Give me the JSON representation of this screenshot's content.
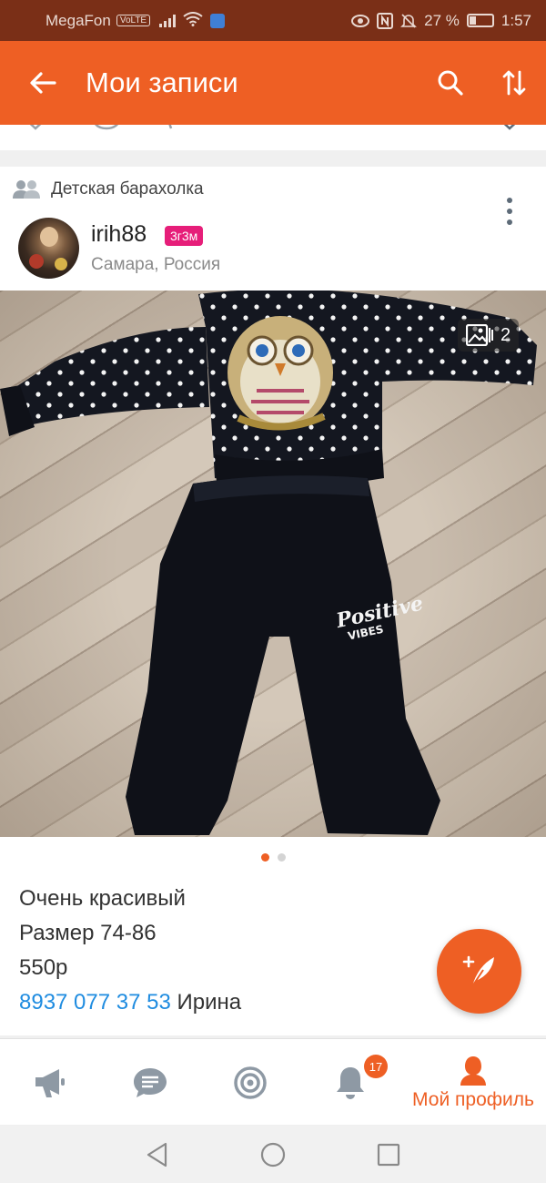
{
  "status_bar": {
    "carrier": "MegaFon",
    "volte": "VoLTE",
    "battery": "27 %",
    "time": "1:57"
  },
  "app_bar": {
    "title": "Мои записи",
    "back_icon": "arrow-left-icon",
    "search_icon": "search-icon",
    "sort_icon": "sort-arrows-icon"
  },
  "post": {
    "group": "Детская барахолка",
    "author": "irih88",
    "badge": "3г3м",
    "location": "Самара, Россия",
    "image_count": "2",
    "text_lines": [
      "Очень красивый",
      "Размер 74-86",
      "550р"
    ],
    "phone": "8937 077 37 53",
    "contact_name": " Ирина",
    "photo_print_text": "Positive VIBES",
    "slides_total": 2,
    "slide_active": 1
  },
  "bottom_nav": {
    "items": [
      {
        "icon": "megaphone-icon",
        "label": ""
      },
      {
        "icon": "chat-icon",
        "label": ""
      },
      {
        "icon": "target-icon",
        "label": ""
      },
      {
        "icon": "bell-icon",
        "label": ""
      },
      {
        "icon": "person-icon",
        "label": "Мой профиль"
      }
    ],
    "notification_count": "17"
  },
  "colors": {
    "accent": "#ee5f24",
    "status_bar": "#7a2f17",
    "badge": "#e61e79",
    "link": "#1f8ce0"
  }
}
